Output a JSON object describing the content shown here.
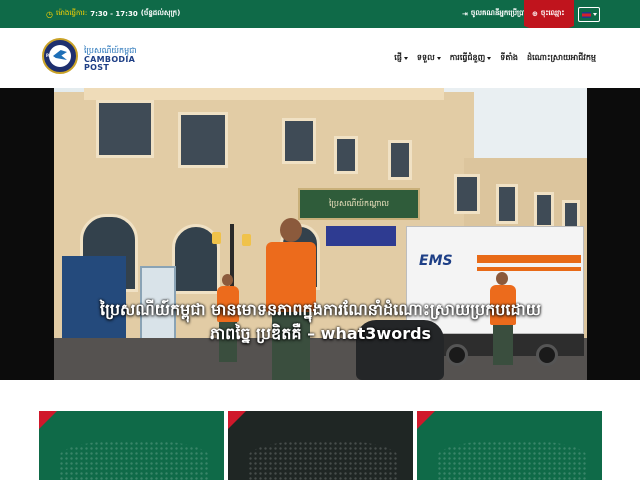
{
  "topbar": {
    "hours_label": "ម៉ោងធ្វើការ:",
    "hours_value": "7:30 - 17:30",
    "hours_days": "(ច័ន្ទដល់សុក្រ)",
    "login": "ចូលគណនីអ្នកប្រើប្រាស់",
    "register": "ចុះឈ្មោះ",
    "language": "km"
  },
  "header": {
    "logo_ring": "P.T.",
    "brand_kh": "ប្រៃសណីយ៍កម្ពុជា",
    "brand_en_line1": "CAMBODIA",
    "brand_en_line2": "POST",
    "nav": [
      {
        "label": "ផ្ញើ",
        "dropdown": true
      },
      {
        "label": "ទទួល",
        "dropdown": true
      },
      {
        "label": "ការធ្វើជំនួញ",
        "dropdown": true
      },
      {
        "label": "ទីតាំង",
        "dropdown": false
      },
      {
        "label": "ដំណោះស្រាយអាជីវកម្ម",
        "dropdown": false
      }
    ]
  },
  "hero": {
    "sign_green": "ប្រៃសណីយ៍កណ្តាល",
    "truck_brand": "EMS",
    "caption_line1": "ប្រៃសណីយ៍កម្ពុជា មានមោទនភាពក្នុងការណែនាំដំណោះស្រាយប្រកបដោយ",
    "caption_line2": "ភាពច្នៃ ប្រឌិតគឺ – what3words"
  },
  "cards": [
    {
      "bg": "#0f6a48"
    },
    {
      "bg": "#1f2624"
    },
    {
      "bg": "#0f6a48"
    }
  ],
  "colors": {
    "primary_green": "#0f6a48",
    "accent_red": "#c0141d",
    "brand_blue": "#1e3f86"
  }
}
